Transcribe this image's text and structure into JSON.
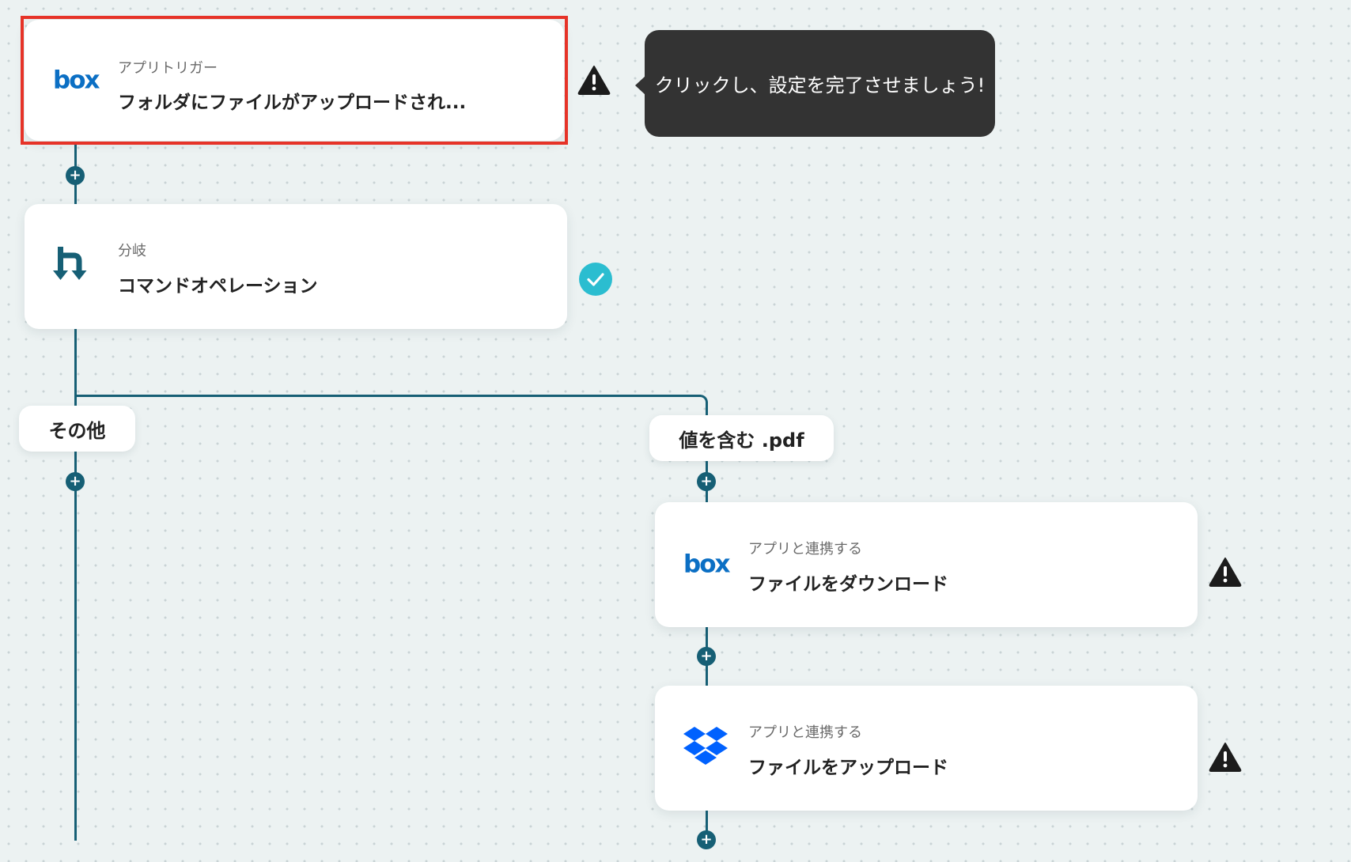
{
  "colors": {
    "connector": "#165f75",
    "selected_border": "#e63328",
    "warning": "#1c1c1c",
    "success": "#2bbdd0",
    "box_brand": "#0b6fc4",
    "dropbox_brand": "#0061fe",
    "tooltip_bg": "#333333"
  },
  "tooltip": {
    "text": "クリックし、設定を完了させましょう!"
  },
  "steps": [
    {
      "label": "アプリトリガー",
      "title": "フォルダにファイルがアップロードされ...",
      "icon": "box-logo",
      "status": "warning",
      "selected": true
    },
    {
      "label": "分岐",
      "title": "コマンドオペレーション",
      "icon": "branch-icon",
      "status": "complete"
    },
    {
      "label": "アプリと連携する",
      "title": "ファイルをダウンロード",
      "icon": "box-logo",
      "status": "warning"
    },
    {
      "label": "アプリと連携する",
      "title": "ファイルをアップロード",
      "icon": "dropbox-logo",
      "status": "warning"
    }
  ],
  "branches": {
    "else_label": "その他",
    "condition_label": "値を含む .pdf"
  },
  "logos": {
    "box_text": "box"
  },
  "add_symbol": "+"
}
